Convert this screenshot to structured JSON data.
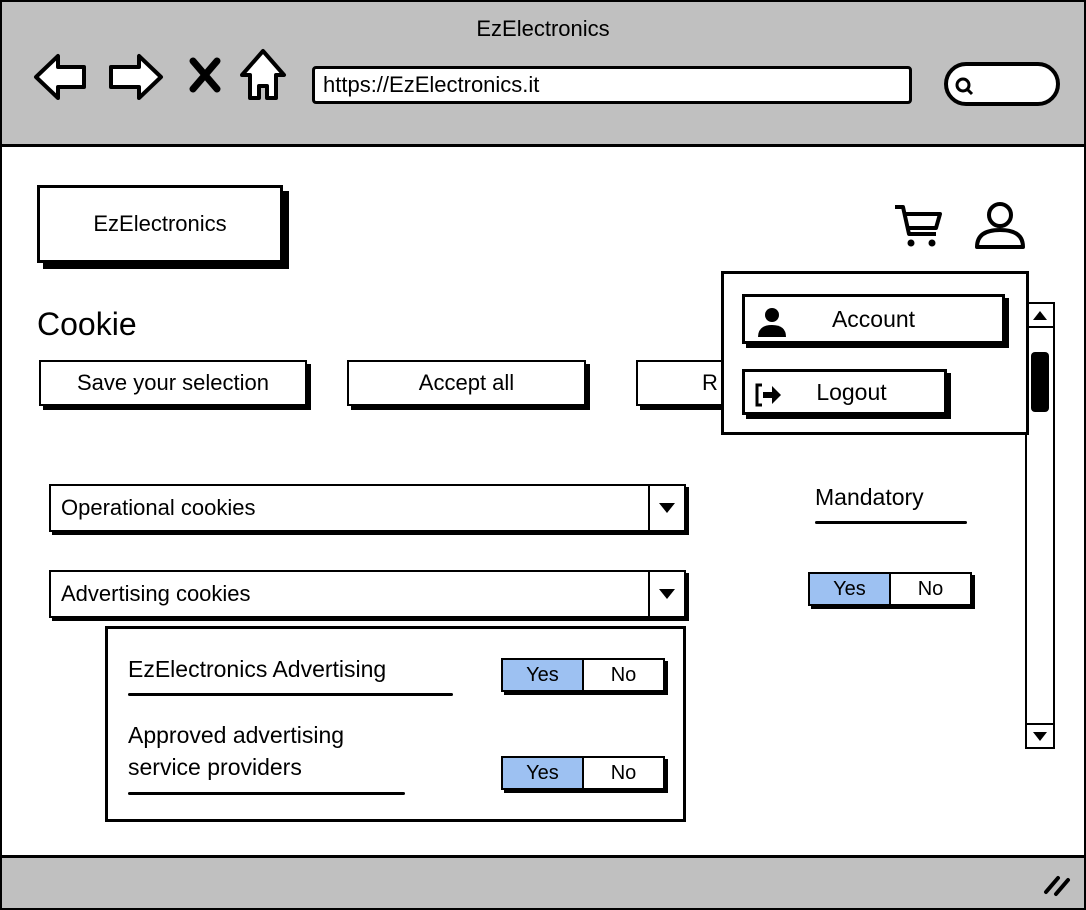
{
  "browser": {
    "title": "EzElectronics",
    "url": "https://EzElectronics.it"
  },
  "header": {
    "logo": "EzElectronics"
  },
  "page": {
    "title": "Cookie",
    "buttons": {
      "save": "Save your selection",
      "accept": "Accept all",
      "third": "R"
    }
  },
  "sections": {
    "operational": "Operational cookies",
    "advertising": "Advertising cookies",
    "mandatory": "Mandatory",
    "ads_items": [
      {
        "label": "EzElectronics Advertising",
        "value": "Yes"
      },
      {
        "label_line1": "Approved advertising",
        "label_line2": "service providers",
        "value": "Yes"
      }
    ]
  },
  "toggle": {
    "yes": "Yes",
    "no": "No",
    "selected_color": "#9dc1f2"
  },
  "user_menu": {
    "account": "Account",
    "logout": "Logout"
  }
}
